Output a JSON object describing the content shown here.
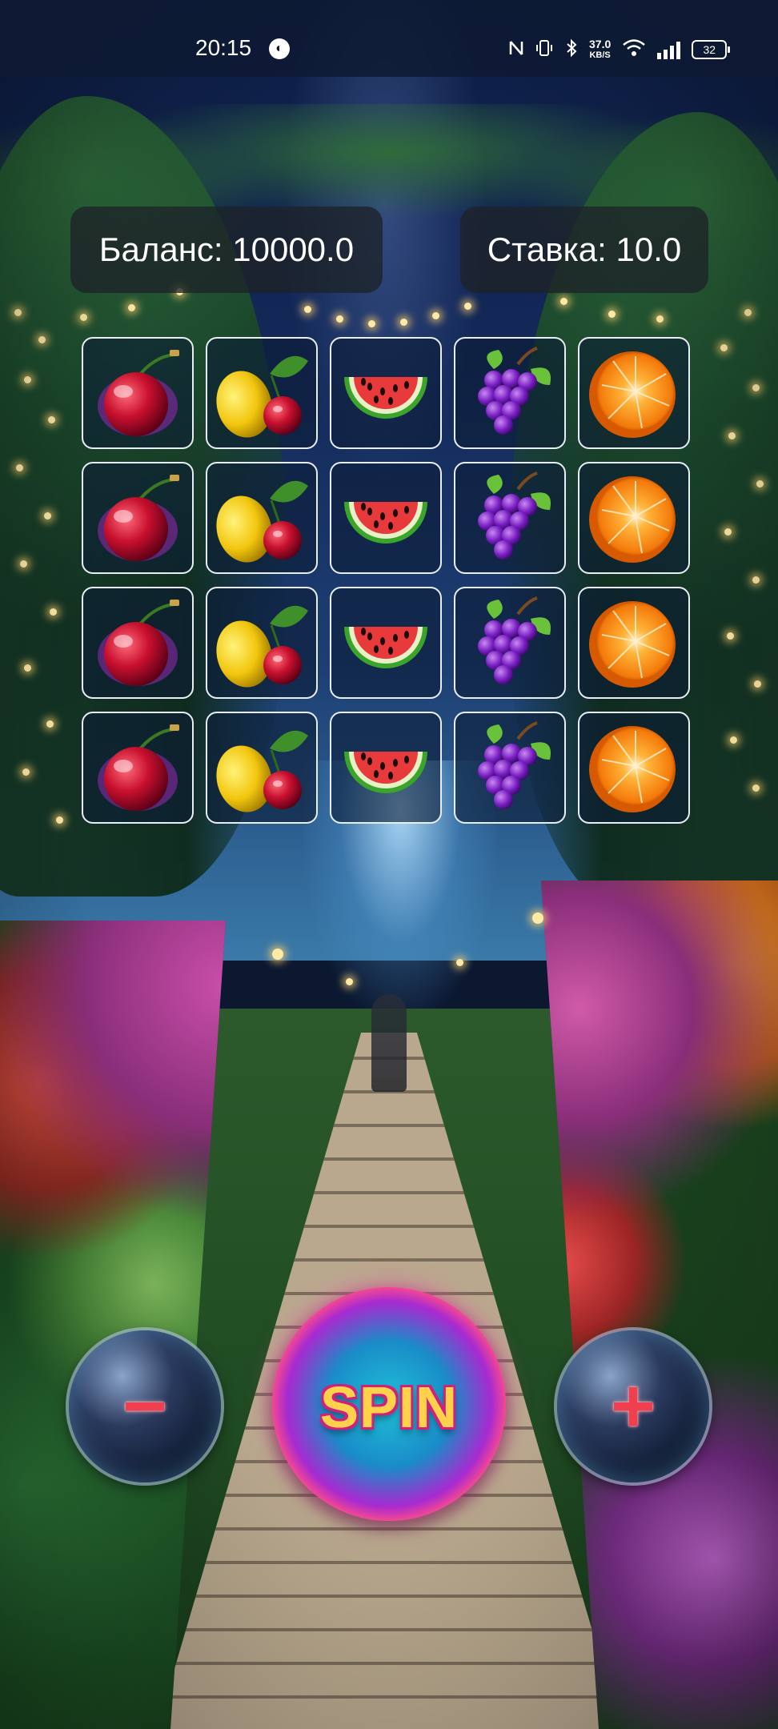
{
  "status_bar": {
    "time": "20:15",
    "app_icon_glyph": "◐",
    "net_speed_value": "37.0",
    "net_speed_unit": "KB/S",
    "battery": "32",
    "icons": [
      "nfc-icon",
      "vibrate-icon",
      "bluetooth-icon",
      "wifi-icon",
      "signal-icon",
      "battery-icon"
    ]
  },
  "game": {
    "balance_label": "Баланс: 10000.0",
    "bet_label": "Ставка: 10.0",
    "spin_label": "SPIN",
    "minus_label": "−",
    "plus_label": "+"
  },
  "reels": {
    "columns": [
      "cherry",
      "lemon-cherry",
      "watermelon",
      "grapes",
      "orange"
    ],
    "rows": 4
  }
}
